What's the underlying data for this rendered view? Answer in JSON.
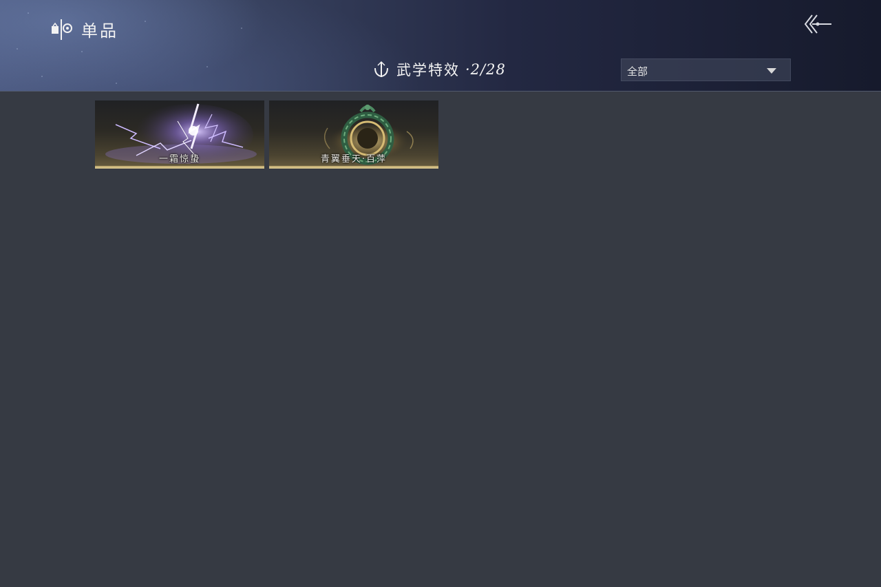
{
  "header": {
    "section_label": "单品",
    "section_icon": "wardrobe-icon",
    "back_icon": "back-arrow-icon"
  },
  "collection": {
    "title": "武学特效",
    "count": "·2/28",
    "icon": "martial-effect-icon"
  },
  "filter": {
    "selected": "全部"
  },
  "items": [
    {
      "label": "一霜惊蛰",
      "theme": "purple-lightning"
    },
    {
      "label": "青翼垂天·百萍",
      "theme": "jade-ring"
    }
  ],
  "colors": {
    "background": "#363a43",
    "header_start": "#4d5b82",
    "header_end": "#161a2c",
    "card_trim": "#e2cf95",
    "lightning": "#b49cff",
    "jade": "#3f7a56"
  }
}
